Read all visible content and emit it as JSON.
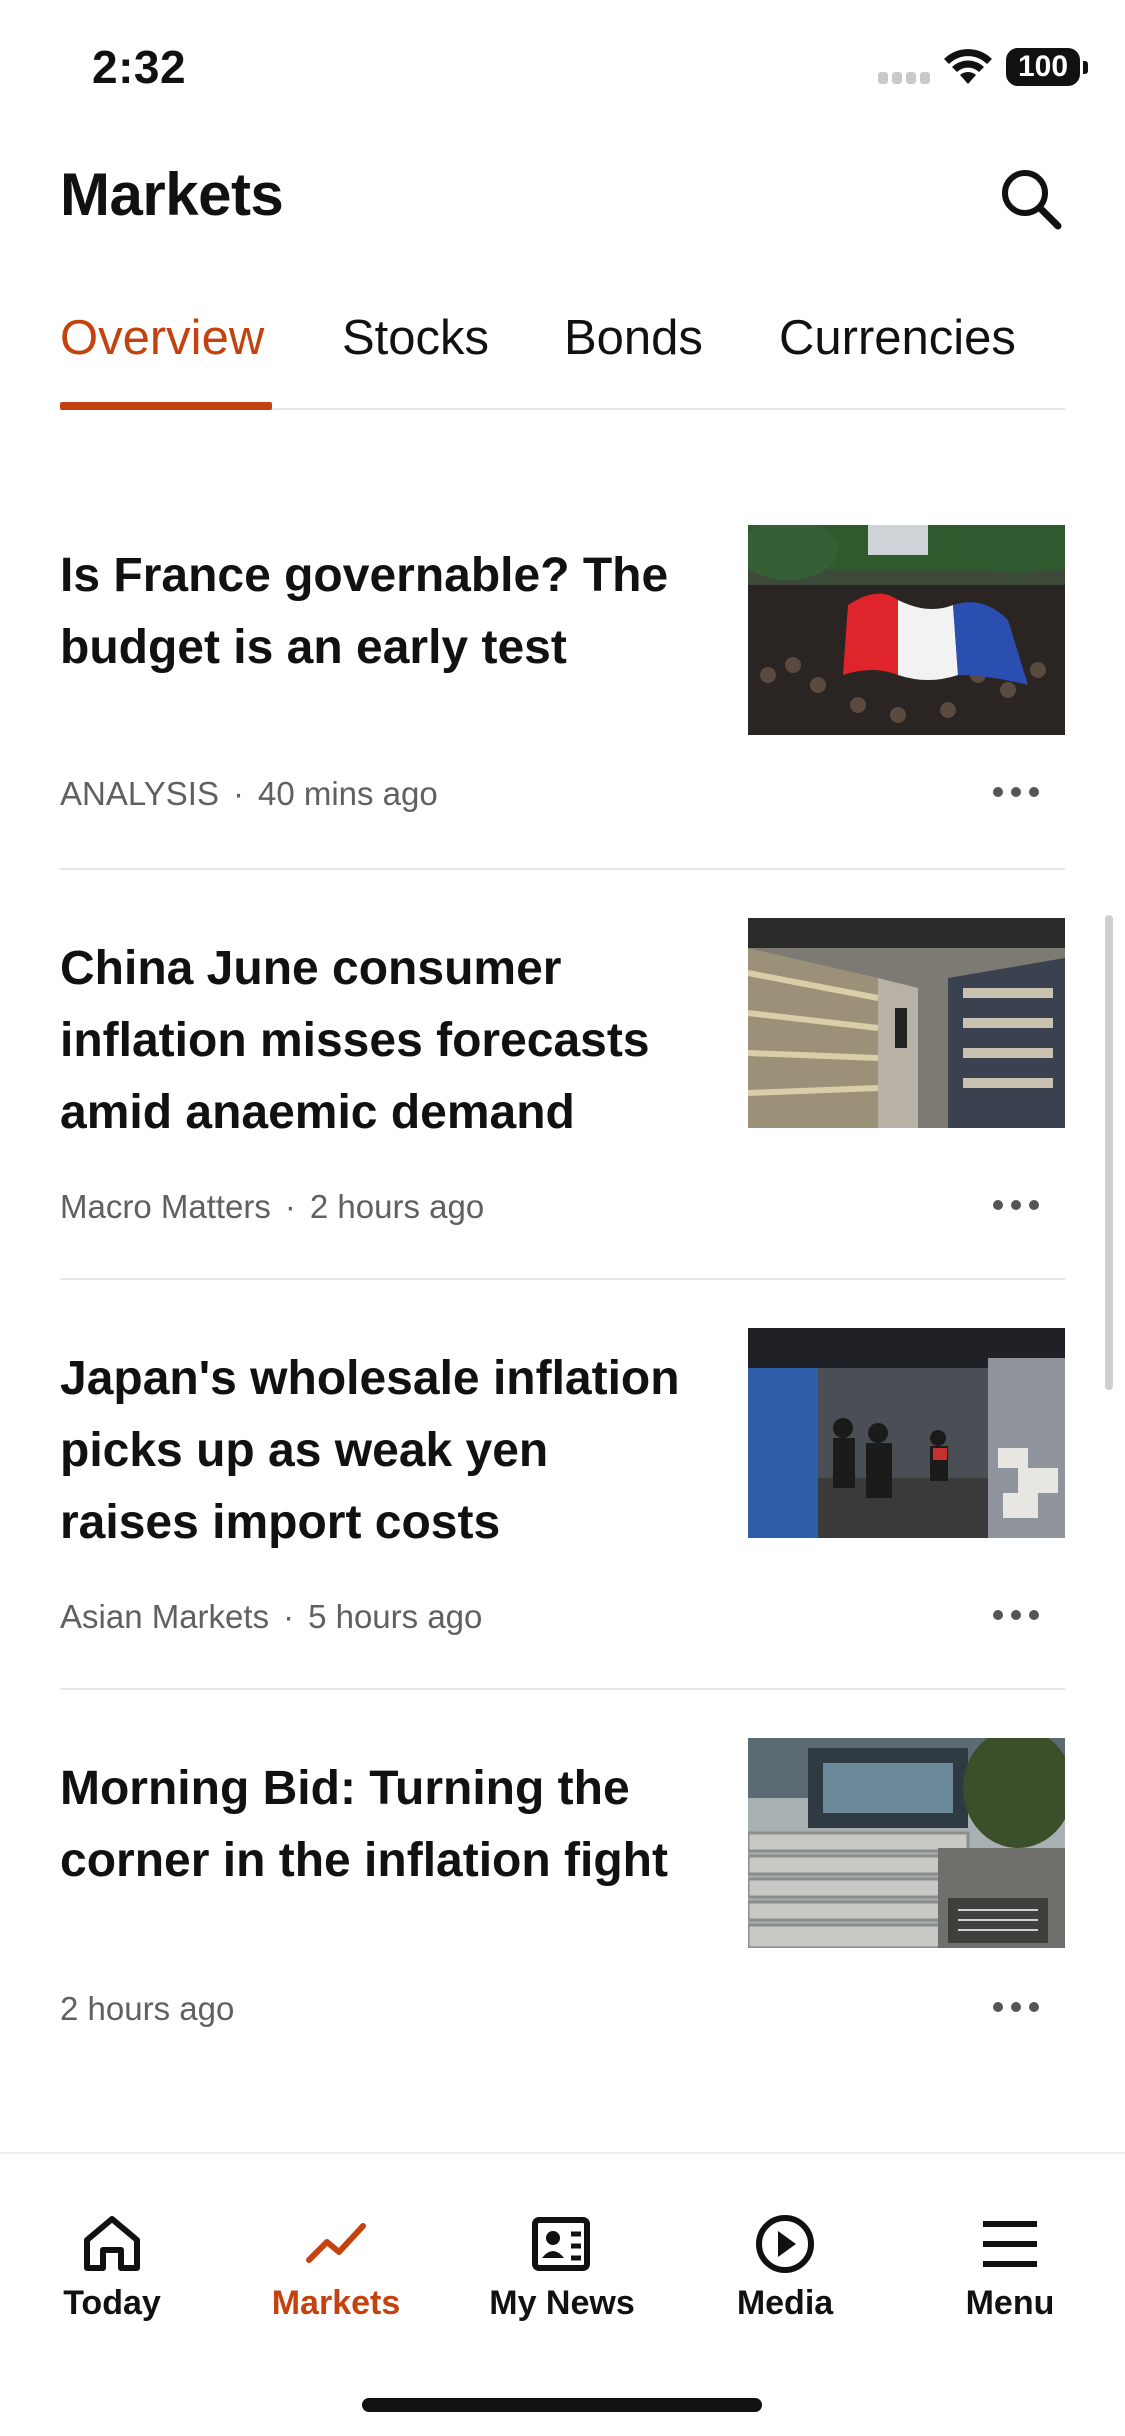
{
  "status": {
    "time": "2:32",
    "battery": "100"
  },
  "header": {
    "title": "Markets"
  },
  "tabs": [
    {
      "label": "Overview",
      "active": true
    },
    {
      "label": "Stocks"
    },
    {
      "label": "Bonds"
    },
    {
      "label": "Currencies"
    }
  ],
  "articles": [
    {
      "title": "Is France governable? The budget is an early test",
      "category": "ANALYSIS",
      "time": "40 mins ago",
      "image": "french-flag-crowd"
    },
    {
      "title": "China June consumer inflation misses forecasts amid anaemic demand",
      "category": "Macro Matters",
      "time": "2 hours ago",
      "image": "supermarket-aisle"
    },
    {
      "title": "Japan's wholesale inflation picks up as weak yen raises import costs",
      "category": "Asian Markets",
      "time": "5 hours ago",
      "image": "market-street"
    },
    {
      "title": "Morning Bid: Turning the corner in the inflation fight",
      "category": "",
      "time": "2 hours ago",
      "image": "bank-building-steps"
    }
  ],
  "nav": [
    {
      "label": "Today",
      "icon": "home-icon"
    },
    {
      "label": "Markets",
      "icon": "trend-line-icon",
      "active": true
    },
    {
      "label": "My News",
      "icon": "newspaper-icon"
    },
    {
      "label": "Media",
      "icon": "play-circle-icon"
    },
    {
      "label": "Menu",
      "icon": "hamburger-icon"
    }
  ],
  "colors": {
    "accent": "#c4420d",
    "text": "#111111",
    "meta": "#606060",
    "divider": "#e6e6e6"
  }
}
